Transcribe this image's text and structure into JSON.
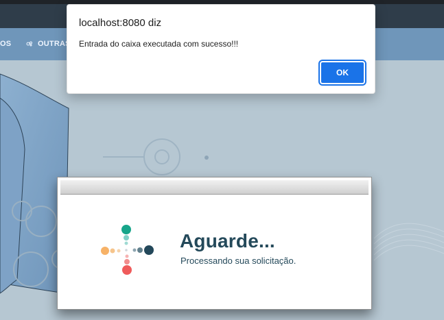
{
  "alert": {
    "origin": "localhost:8080 diz",
    "message": "Entrada do caixa executada com sucesso!!!",
    "ok_label": "OK"
  },
  "nav": {
    "item_left": "OS",
    "item_right": "OUTRAS C"
  },
  "loading": {
    "title": "Aguarde...",
    "subtitle": "Processando sua solicitação."
  },
  "colors": {
    "page_bg": "#b6c7d2",
    "topbar": "#2f3d4a",
    "nav_bg": "#6f96ba",
    "accent": "#1a73e8",
    "loading_text": "#24495a"
  },
  "icons": {
    "nav_right": "gears-icon",
    "loader": "loading-dots-icon"
  }
}
